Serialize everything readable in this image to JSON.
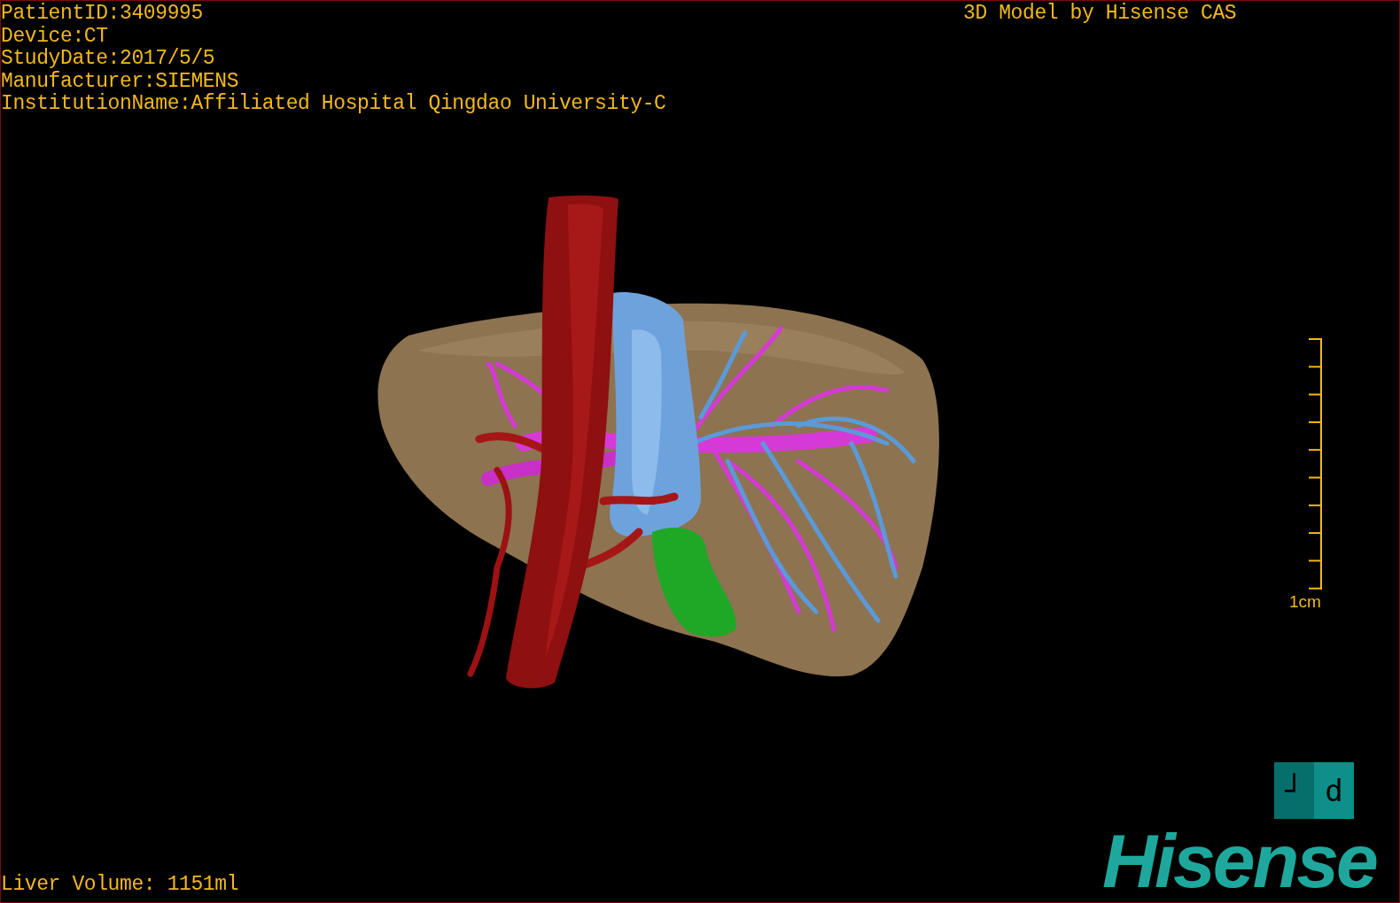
{
  "viewport": {
    "info_lines": [
      "PatientID:3409995",
      "Device:CT",
      "StudyDate:2017/5/5",
      "Manufacturer:SIEMENS",
      "InstitutionName:Affiliated Hospital Qingdao University-C"
    ],
    "title": "3D Model by Hisense CAS",
    "scale_bar": {
      "label": "1cm"
    },
    "orientation_cube": {
      "faces": [
        "┘",
        "d"
      ]
    },
    "volume_readout": "Liver Volume: 1151ml",
    "logo": "Hisense"
  }
}
